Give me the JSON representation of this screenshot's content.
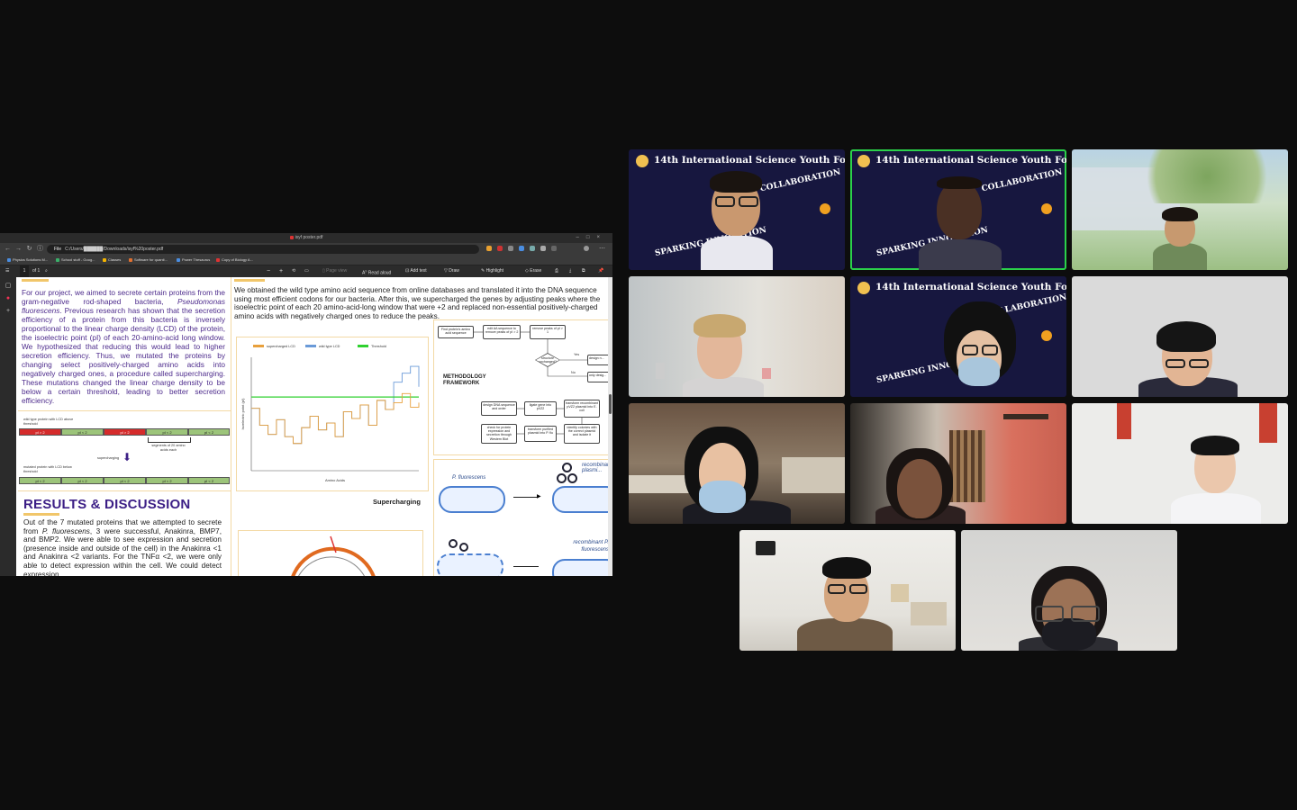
{
  "browser": {
    "tab_title": "isyf poster.pdf",
    "url_label": "File",
    "url": "C:/Users/██████/Downloads/isyf%20poster.pdf",
    "bookmarks": [
      "Physics Solutions M...",
      "School stuff - Goog...",
      "Classes",
      "Software for quanti...",
      "Power Thesaurus",
      "Copy of Biology A..."
    ]
  },
  "pdf_toolbar": {
    "page_number": "1",
    "page_of": "of 1",
    "zoom_out": "−",
    "zoom_in": "+",
    "page_view": "Page view",
    "read_aloud": "Read aloud",
    "add_text": "Add text",
    "draw": "Draw",
    "highlight": "Highlight",
    "erase": "Erase"
  },
  "poster": {
    "intro_text_1": "For our project, we aimed to secrete certain proteins from the gram-negative rod-shaped bacteria,",
    "intro_species": "Pseudomonas fluorescens",
    "intro_text_2": ". Previous research has shown that the secretion efficiency of a protein from this bacteria is inversely proportional to the linear charge density (LCD) of the protein, the isoelectric point (pI) of each 20-amino-acid long window. We hypothesized that reducing this would lead to higher secretion efficiency. Thus, we mutated the proteins by changing select positively-charged amino acids into negatively charged ones, a procedure called supercharging. These mutations changed the linear charge density to be below a certain threshold, leading to better secretion efficiency.",
    "middle_text": "We obtained the wild type amino acid sequence from online databases and translated it into the DNA sequence using most efficient codons for our bacteria. After this, we supercharged the genes by adjusting peaks where the isoelectric point of each 20 amino-acid-long window that were +2 and replaced non-essential positively-charged amino acids with negatively charged ones to reduce the peaks.",
    "wild_type_label": "wild type protein with LCD above threshold",
    "wild_segments": [
      "pI > 2",
      "pI < 2",
      "pI > 2",
      "pI < 2",
      "pI < 2"
    ],
    "segments_note": "segments of 20 amino acids each",
    "supercharging_note": "supercharging",
    "mutated_label": "mutated protein with LCD below threshold",
    "mutated_segments": [
      "pI < 2",
      "pI < 2",
      "pI < 2",
      "pI < 2",
      "pI < 2"
    ],
    "results_heading": "RESULTS & DISCUSSION",
    "results_text_1": "Out of the 7 mutated proteins that we attempted to secrete from",
    "results_species": "P. fluorescens",
    "results_text_2": ", 3 were successful, Anakinra, BMP7, and BMP2. We were able to see expression and secretion (presence inside and outside of the cell) in the Anakinra <1 and Anakinra <2 variants. For the TNFα <2, we were only able to detect expression within the cell. We could detect expression",
    "chart_caption": "Supercharging",
    "methodology_heading": "METHODOLOGY FRAMEWORK",
    "flow": {
      "b1": "Find protein's amino acid sequence",
      "b2": "edit AA sequence to remove peaks of pI > 2",
      "b3": "remove peaks of pI > 1",
      "decision": "structure unchanged?",
      "yes": "Yes",
      "no": "No",
      "b4": "design n...",
      "b5": "only desig...",
      "b6": "design DNA sequence and order",
      "b7": "ligate gene into pVZ2",
      "b8": "transform recombinant pVZ2 plasmid into E. coli",
      "b9": "check for protein expression and secretion through Western Blot",
      "b10": "transform purified plasmid into P. flu",
      "b11": "identify colonies with the correct plasmid and isolate it"
    },
    "pf_label": "P. fluorescens",
    "recomb_label_1": "recombinant plasmi...",
    "recomb_label_2": "recombinant P. fluorescens"
  },
  "chart_data": {
    "type": "line",
    "title": "",
    "xlabel": "Amino Acids",
    "ylabel": "Isoelectric point (pI)",
    "legend": [
      "supercharged LCD",
      "wild type LCD",
      "Threshold"
    ],
    "legend_position": "top",
    "colors": {
      "supercharged LCD": "#e8a03c",
      "wild type LCD": "#6a9ad8",
      "Threshold": "#2fd12f"
    },
    "x": [
      0,
      10,
      20,
      30,
      40,
      50,
      60,
      70,
      80,
      90,
      100,
      110,
      120,
      130,
      140,
      150,
      160,
      170,
      180,
      190,
      200
    ],
    "ylim": [
      0,
      10
    ],
    "series": [
      {
        "name": "supercharged LCD",
        "values": [
          5.5,
          4.0,
          3.2,
          4.5,
          3.0,
          2.4,
          3.8,
          4.8,
          3.6,
          4.2,
          3.0,
          5.2,
          4.6,
          5.8,
          4.0,
          6.2,
          5.4,
          6.0,
          6.8,
          5.6,
          6.0
        ]
      },
      {
        "name": "wild type LCD",
        "values": [
          5.5,
          4.0,
          3.2,
          4.5,
          3.0,
          2.4,
          3.8,
          4.8,
          3.6,
          4.2,
          3.0,
          5.2,
          4.6,
          5.8,
          4.0,
          6.2,
          5.4,
          7.8,
          8.6,
          9.2,
          7.4
        ]
      },
      {
        "name": "Threshold",
        "values": [
          6.5,
          6.5,
          6.5,
          6.5,
          6.5,
          6.5,
          6.5,
          6.5,
          6.5,
          6.5,
          6.5,
          6.5,
          6.5,
          6.5,
          6.5,
          6.5,
          6.5,
          6.5,
          6.5,
          6.5,
          6.5
        ]
      }
    ]
  },
  "meeting": {
    "forum_title": "14th International Science Youth Forum",
    "doodle_1": "COLLABORATION",
    "doodle_2": "SPARKING INNOVATION",
    "active_speaker_color": "#2bd14a"
  }
}
